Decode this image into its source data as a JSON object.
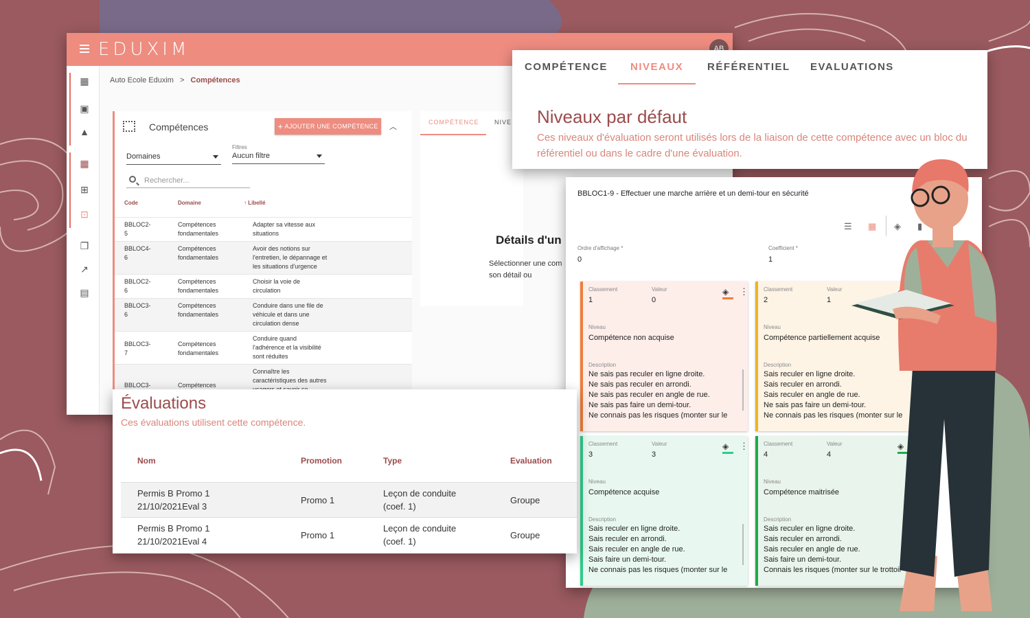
{
  "app": {
    "logo": "EDUXIM",
    "avatar_initials": "AB",
    "breadcrumb_root": "Auto Ecole Eduxim",
    "breadcrumb_sep": ">",
    "breadcrumb_current": "Compétences",
    "rail_icons": [
      "school-building-icon",
      "dashboard-icon",
      "graduation-cap-icon",
      "grid-apps-icon",
      "hierarchy-icon",
      "competence-icon",
      "library-icon",
      "trending-icon",
      "bar-chart-icon"
    ]
  },
  "list": {
    "title": "Compétences",
    "add_button": "AJOUTER UNE COMPÉTENCE",
    "domain_select": "Domaines",
    "filter_label": "Filtres",
    "filter_value": "Aucun filtre",
    "search_placeholder": "Rechercher...",
    "columns": {
      "code": "Code",
      "domain": "Domaine",
      "label": "Libellé"
    },
    "rows": [
      {
        "code": "BBLOC2-\n5",
        "domain": "Compétences\nfondamentales",
        "label": "Adapter sa vitesse aux\nsituations"
      },
      {
        "code": "BBLOC4-\n6",
        "domain": "Compétences\nfondamentales",
        "label": "Avoir des notions sur\nl'entretien, le dépannage et\nles situations d'urgence"
      },
      {
        "code": "BBLOC2-\n6",
        "domain": "Compétences\nfondamentales",
        "label": "Choisir la voie de\ncirculation"
      },
      {
        "code": "BBLOC3-\n6",
        "domain": "Compétences\nfondamentales",
        "label": "Conduire dans une file de\nvéhicule et dans une\ncirculation dense"
      },
      {
        "code": "BBLOC3-\n7",
        "domain": "Compétences\nfondamentales",
        "label": "Conduire quand\nl'adhérence et la visibilité\nsont réduites"
      },
      {
        "code": "BBLOC3-",
        "domain": "Compétences",
        "label": "Connaître les\ncaractéristiques des autres\nusagers et savoir se"
      }
    ]
  },
  "detail": {
    "tab1": "COMPÉTENCE",
    "tab2": "NIVE",
    "title": "Détails d'un",
    "text": "Sélectionner une com\nson détail ou"
  },
  "niveaux_tabs": {
    "tabs": [
      "COMPÉTENCE",
      "NIVEAUX",
      "RÉFÉRENTIEL",
      "EVALUATIONS"
    ],
    "active": "NIVEAUX",
    "title": "Niveaux par défaut",
    "description": "Ces niveaux d'évaluation seront utilisés lors de la liaison de cette compétence avec un bloc du référentiel ou dans le cadre d'une évaluation."
  },
  "bloc": {
    "title": "BBLOC1-9 - Effectuer une marche arrière et un demi-tour en sécurité",
    "order_label": "Ordre d'affichage *",
    "order_value": "0",
    "coef_label": "Coefficient *",
    "coef_value": "1",
    "labels": {
      "classement": "Classement",
      "valeur": "Valeur",
      "niveau": "Niveau",
      "description": "Description"
    },
    "levels": [
      {
        "classement": "1",
        "valeur": "0",
        "niveau": "Compétence non acquise",
        "color": "#f07d3a",
        "bg": "#fdeeea",
        "description": "Ne sais pas reculer en ligne droite.\nNe sais pas reculer en arrondi.\nNe sais pas reculer en angle de rue.\nNe sais pas faire un demi-tour.\nNe connais pas les risques (monter sur le"
      },
      {
        "classement": "2",
        "valeur": "1",
        "niveau": "Compétence partiellement acquise",
        "color": "#f0b323",
        "bg": "#fdf4e6",
        "description": "Sais reculer en ligne droite.\nSais reculer en arrondi.\nSais reculer en angle de rue.\nNe sais pas faire un demi-tour.\nNe connais pas les risques (monter sur le"
      },
      {
        "classement": "3",
        "valeur": "3",
        "niveau": "Compétence acquise",
        "color": "#2ecc8a",
        "bg": "#e8f8f0",
        "description": "Sais reculer en ligne droite.\nSais reculer en arrondi.\nSais reculer en angle de rue.\nSais faire un demi-tour.\nNe connais pas les risques (monter sur le"
      },
      {
        "classement": "4",
        "valeur": "4",
        "niveau": "Compétence maitrisée",
        "color": "#1faa4a",
        "bg": "#e9f4ec",
        "description": "Sais reculer en ligne droite.\nSais reculer en arrondi.\nSais reculer en angle de rue.\nSais faire un demi-tour.\nConnais les risques (monter sur le trottoir"
      }
    ]
  },
  "evaluations": {
    "title": "Évaluations",
    "subtitle": "Ces évaluations utilisent cette compétence.",
    "columns": {
      "nom": "Nom",
      "promotion": "Promotion",
      "type": "Type",
      "evaluation": "Evaluation"
    },
    "rows": [
      {
        "nom": "Permis B Promo 1\n21/10/2021Eval 3",
        "promotion": "Promo 1",
        "type": "Leçon de conduite\n(coef. 1)",
        "evaluation": "Groupe"
      },
      {
        "nom": "Permis B Promo 1\n21/10/2021Eval 4",
        "promotion": "Promo 1",
        "type": "Leçon de conduite\n(coef. 1)",
        "evaluation": "Groupe"
      }
    ]
  },
  "colors": {
    "brand": "#ee8c80",
    "brand_dark": "#9b4b4b",
    "background": "#9a5a5f"
  }
}
